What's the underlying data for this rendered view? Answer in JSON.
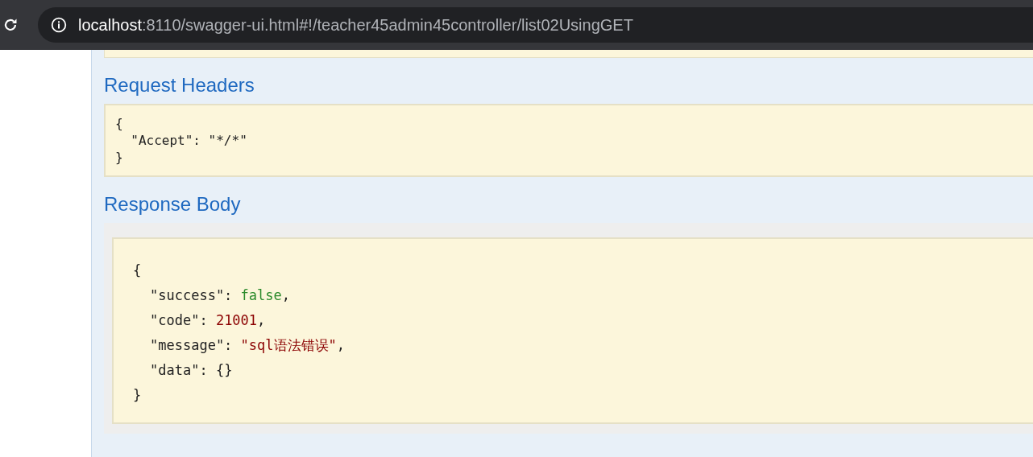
{
  "address_bar": {
    "host": "localhost",
    "path": ":8110/swagger-ui.html#!/teacher45admin45controller/list02UsingGET"
  },
  "request_headers": {
    "title": "Request Headers",
    "lines": [
      "{",
      "  \"Accept\": \"*/*\"",
      "}"
    ]
  },
  "response_body": {
    "title": "Response Body",
    "open": "{",
    "close": "}",
    "entries": [
      {
        "key": "\"success\":",
        "value": "false",
        "kind": "boolean",
        "trail": ","
      },
      {
        "key": "\"code\":",
        "value": "21001",
        "kind": "number",
        "trail": ","
      },
      {
        "key": "\"message\":",
        "value": "\"sql语法错误\"",
        "kind": "string",
        "trail": ","
      },
      {
        "key": "\"data\":",
        "value": "{}",
        "kind": "object"
      }
    ]
  }
}
